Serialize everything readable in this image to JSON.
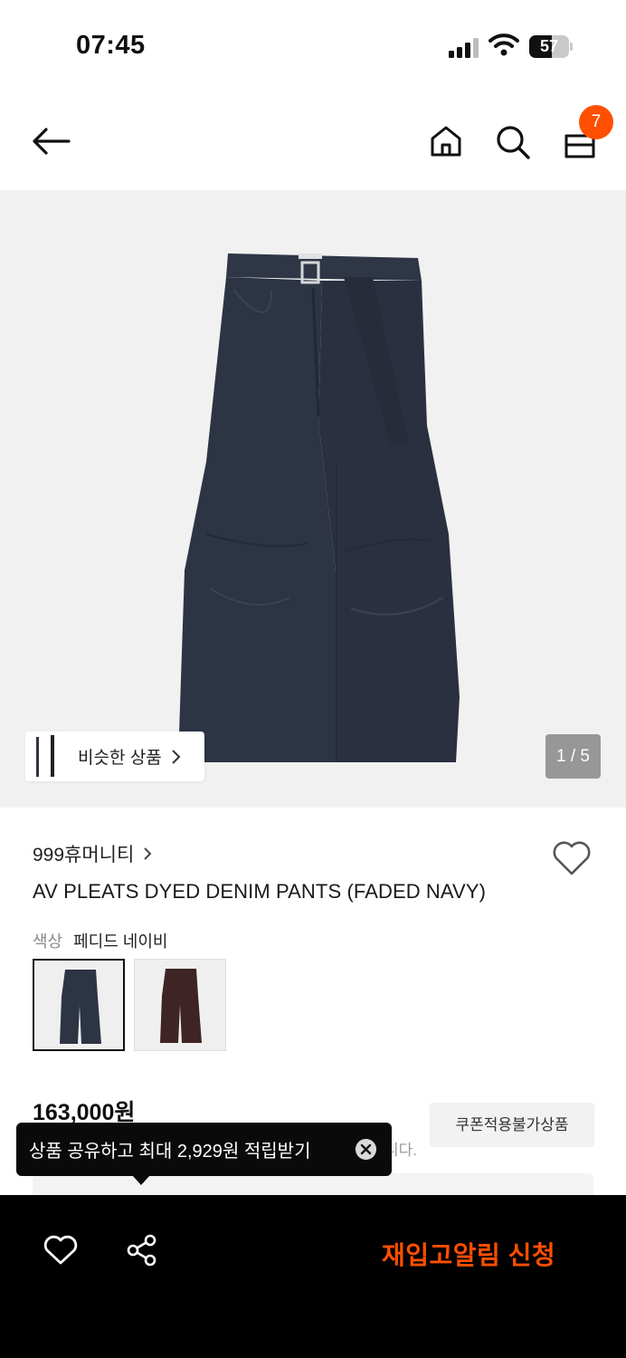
{
  "status_bar": {
    "time": "07:45",
    "battery": "57",
    "battery_level": 0.57
  },
  "nav": {
    "cart_count": "7",
    "icons": [
      "back-arrow-icon",
      "home-icon",
      "search-icon",
      "cart-icon"
    ]
  },
  "hero": {
    "similar_label": "비슷한 상품",
    "pager": "1 / 5",
    "image": "faded navy wide denim pants with belt"
  },
  "product": {
    "brand": "999휴머니티",
    "title": "AV PLEATS DYED DENIM PANTS (FADED NAVY)",
    "color_key": "색상",
    "color_value": "페디드 네이비",
    "swatches": [
      "faded-navy",
      "brown"
    ],
    "price": "163,000원",
    "coupon_label": "쿠폰적용불가상품",
    "notice_tail": "니다."
  },
  "tooltip": {
    "text": "상품 공유하고 최대 2,929원 적립받기"
  },
  "bottom_bar": {
    "restock_label": "재입고알림 신청"
  },
  "colors": {
    "accent": "#ff4f00",
    "bottom_bar": "#000000",
    "hero_bg": "#f1f1f1",
    "denim_navy": "#2d3444",
    "denim_brown": "#3e2424"
  }
}
